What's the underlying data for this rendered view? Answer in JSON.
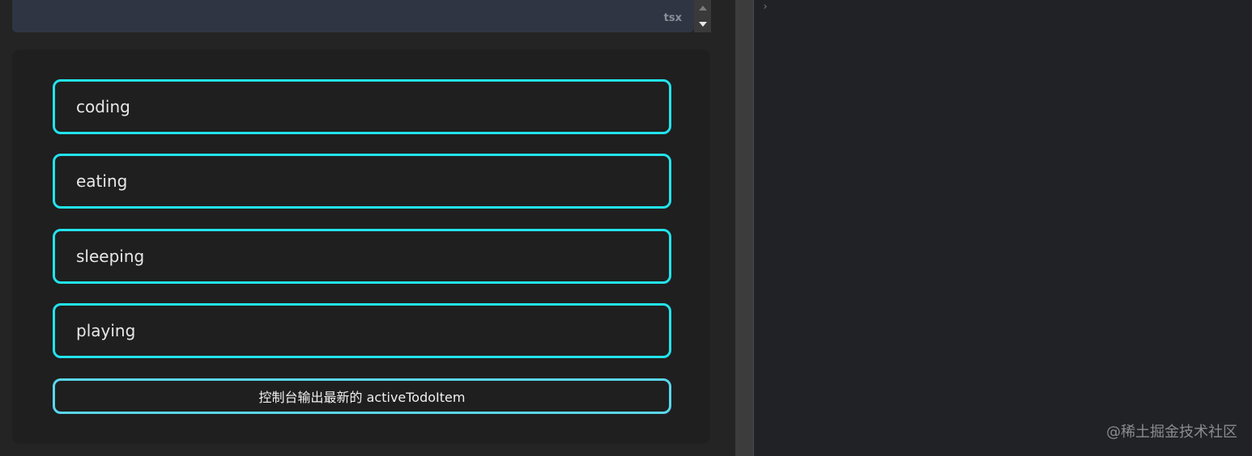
{
  "editor": {
    "language_badge": "tsx"
  },
  "todos": [
    {
      "label": "coding"
    },
    {
      "label": "eating"
    },
    {
      "label": "sleeping"
    },
    {
      "label": "playing"
    }
  ],
  "action": {
    "label": "控制台输出最新的 activeTodoItem"
  },
  "console": {
    "prompt": "›"
  },
  "watermark": {
    "text": "@稀土掘金技术社区"
  },
  "colors": {
    "accent_border": "#22e3ec",
    "button_border": "#5ad6ee",
    "card_bg": "#1f1f1f",
    "console_bg": "#212226"
  }
}
